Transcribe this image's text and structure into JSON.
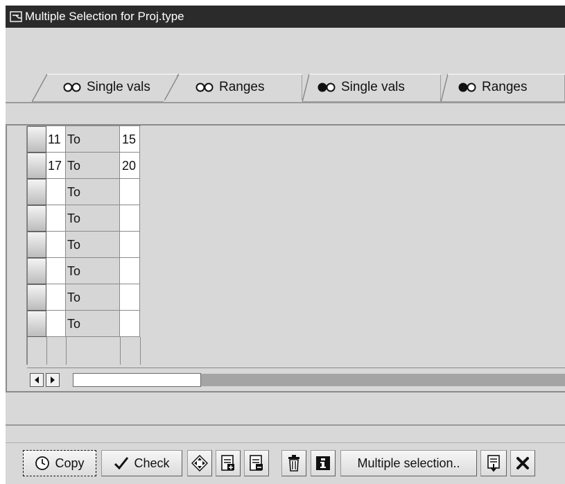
{
  "window": {
    "title": "Multiple Selection for Proj.type"
  },
  "tabs": [
    {
      "label": "Single vals",
      "icon": "radio-pair-outline-icon",
      "active": false
    },
    {
      "label": "Ranges",
      "icon": "radio-pair-outline-icon",
      "active": true
    },
    {
      "label": "Single vals",
      "icon": "radio-pair-filled-icon",
      "active": false
    },
    {
      "label": "Ranges",
      "icon": "radio-pair-filled-icon",
      "active": false
    }
  ],
  "table": {
    "rows": [
      {
        "low": "11",
        "op": "To",
        "high": "15"
      },
      {
        "low": "17",
        "op": "To",
        "high": "20"
      },
      {
        "low": "",
        "op": "To",
        "high": ""
      },
      {
        "low": "",
        "op": "To",
        "high": ""
      },
      {
        "low": "",
        "op": "To",
        "high": ""
      },
      {
        "low": "",
        "op": "To",
        "high": ""
      },
      {
        "low": "",
        "op": "To",
        "high": ""
      },
      {
        "low": "",
        "op": "To",
        "high": ""
      }
    ]
  },
  "toolbar": {
    "copy_label": "Copy",
    "check_label": "Check",
    "multiple_label": "Multiple selection..",
    "icons": [
      "clock-icon",
      "check-icon",
      "diamond-arrows-icon",
      "insert-line-icon",
      "delete-line-icon",
      "trash-icon",
      "info-icon",
      "import-icon",
      "close-icon"
    ]
  },
  "colors": {
    "titlebar": "#2b2b2b",
    "background": "#d8d8d8",
    "cell_input": "#ffffff",
    "cell_readonly": "#d6d6d6"
  }
}
